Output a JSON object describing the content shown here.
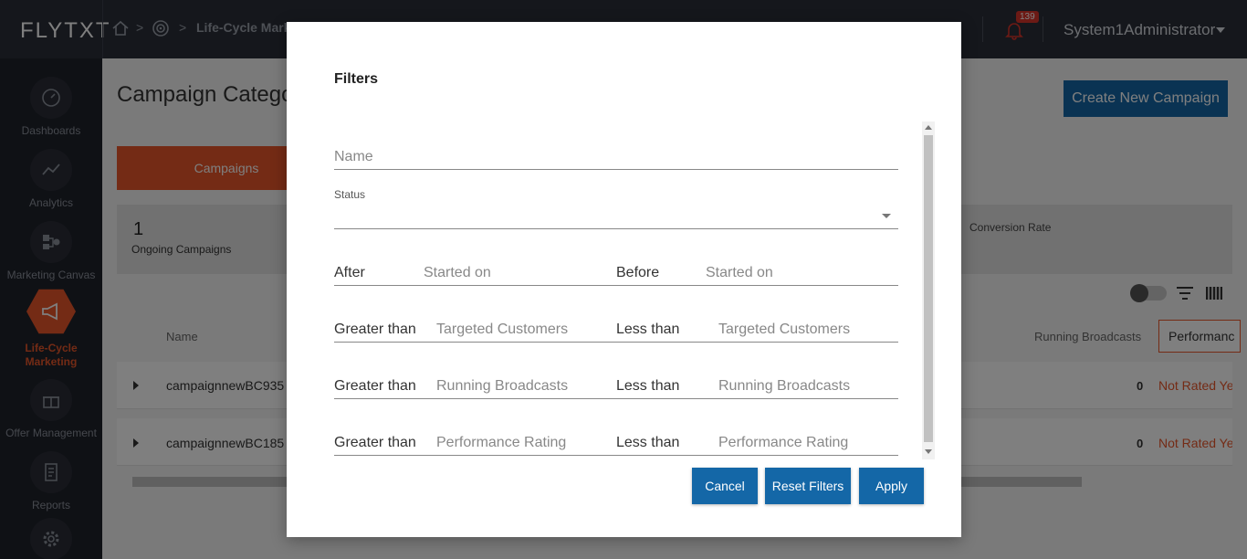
{
  "brand": {
    "logo": "FLYTXT",
    "accent": "#e8562a",
    "primary": "#1467a7"
  },
  "header": {
    "breadcrumb": [
      "home-icon",
      "target-icon",
      "Life-Cycle Marke"
    ],
    "notifications_count": "139",
    "user_name": "System1Administrator"
  },
  "sidebar": {
    "items": [
      {
        "label": "Dashboards",
        "icon": "gauge-icon"
      },
      {
        "label": "Analytics",
        "icon": "line-chart-icon"
      },
      {
        "label": "Marketing Canvas",
        "icon": "canvas-icon"
      },
      {
        "label": "Life-Cycle Marketing",
        "icon": "megaphone-icon",
        "active": true
      },
      {
        "label": "Offer Management",
        "icon": "gift-icon"
      },
      {
        "label": "Reports",
        "icon": "report-icon"
      },
      {
        "label": "",
        "icon": "gear-icon"
      }
    ]
  },
  "main": {
    "title": "Campaign Catego",
    "create_button": "Create New Campaign",
    "tab_active": "Campaigns",
    "stats": {
      "ongoing_count": "1",
      "ongoing_label": "Ongoing Campaigns",
      "conversion_label": "Conversion Rate"
    },
    "table": {
      "col_name": "Name",
      "col_running": "Running Broadcasts",
      "col_performance": "Performanc",
      "rows": [
        {
          "name": "campaignnewBC935",
          "running": "0",
          "rating": "Not Rated Ye"
        },
        {
          "name": "campaignnewBC185",
          "running": "0",
          "rating": "Not Rated Ye"
        }
      ]
    }
  },
  "modal": {
    "title": "Filters",
    "name_placeholder": "Name",
    "status_label": "Status",
    "status_value": "",
    "started_after_label": "After",
    "started_after_placeholder": "Started on",
    "started_before_label": "Before",
    "started_before_placeholder": "Started on",
    "rows": [
      {
        "gt_label": "Greater than",
        "gt_placeholder": "Targeted Customers",
        "lt_label": "Less than",
        "lt_placeholder": "Targeted Customers"
      },
      {
        "gt_label": "Greater than",
        "gt_placeholder": "Running Broadcasts",
        "lt_label": "Less than",
        "lt_placeholder": "Running Broadcasts"
      },
      {
        "gt_label": "Greater than",
        "gt_placeholder": "Performance Rating",
        "lt_label": "Less than",
        "lt_placeholder": "Performance Rating"
      }
    ],
    "buttons": {
      "cancel": "Cancel",
      "reset": "Reset Filters",
      "apply": "Apply"
    }
  }
}
